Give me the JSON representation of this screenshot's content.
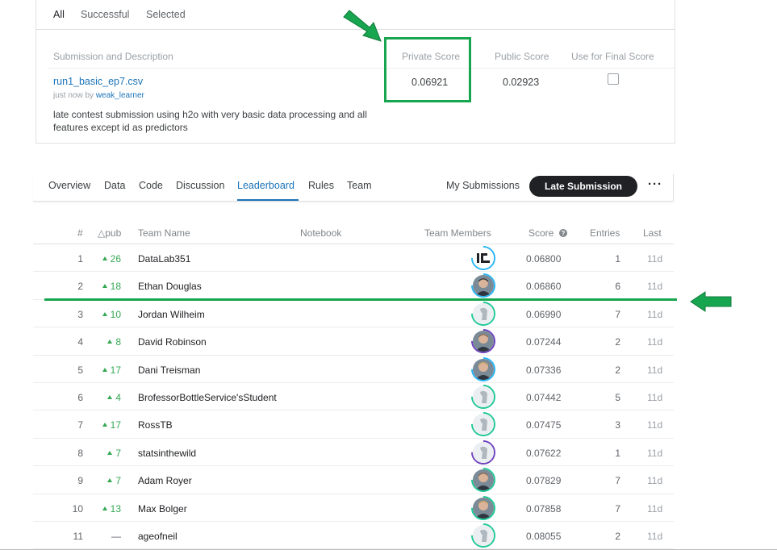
{
  "submissions": {
    "tabs": [
      "All",
      "Successful",
      "Selected"
    ],
    "headers": {
      "description": "Submission and Description",
      "private": "Private Score",
      "public": "Public Score",
      "final": "Use for Final Score"
    },
    "row": {
      "file": "run1_basic_ep7.csv",
      "time": "just now by ",
      "user": "weak_learner",
      "description": "late contest submission using h2o with very basic data processing and all features except id as predictors",
      "private_score": "0.06921",
      "public_score": "0.02923",
      "use_for_final": false
    }
  },
  "nav": {
    "tabs": [
      "Overview",
      "Data",
      "Code",
      "Discussion",
      "Leaderboard",
      "Rules",
      "Team"
    ],
    "active_tab": "Leaderboard",
    "my_submissions": "My Submissions",
    "late_submission": "Late Submission",
    "more": "···"
  },
  "leaderboard": {
    "headers": {
      "rank": "#",
      "delta": "△pub",
      "team": "Team Name",
      "notebook": "Notebook",
      "members": "Team Members",
      "score": "Score",
      "entries": "Entries",
      "last": "Last"
    },
    "rows": [
      {
        "rank": "1",
        "delta": "26",
        "team": "DataLab351",
        "score": "0.06800",
        "entries": "1",
        "last": "11d",
        "ring": "#29b6f6",
        "avatar": "logo"
      },
      {
        "rank": "2",
        "delta": "18",
        "team": "Ethan Douglas",
        "score": "0.06860",
        "entries": "6",
        "last": "11d",
        "ring": "#29b6f6",
        "avatar": "photo"
      },
      {
        "rank": "3",
        "delta": "10",
        "team": "Jordan Wilheim",
        "score": "0.06990",
        "entries": "7",
        "last": "11d",
        "ring": "#20c997",
        "avatar": "default"
      },
      {
        "rank": "4",
        "delta": "8",
        "team": "David Robinson",
        "score": "0.07244",
        "entries": "2",
        "last": "11d",
        "ring": "#6f42c1",
        "avatar": "photo"
      },
      {
        "rank": "5",
        "delta": "17",
        "team": "Dani Treisman",
        "score": "0.07336",
        "entries": "2",
        "last": "11d",
        "ring": "#29b6f6",
        "avatar": "photo"
      },
      {
        "rank": "6",
        "delta": "4",
        "team": "BrofessorBottleService'sStudent",
        "score": "0.07442",
        "entries": "5",
        "last": "11d",
        "ring": "#20c997",
        "avatar": "default"
      },
      {
        "rank": "7",
        "delta": "17",
        "team": "RossTB",
        "score": "0.07475",
        "entries": "3",
        "last": "11d",
        "ring": "#20c997",
        "avatar": "default"
      },
      {
        "rank": "8",
        "delta": "7",
        "team": "statsinthewild",
        "score": "0.07622",
        "entries": "1",
        "last": "11d",
        "ring": "#6f42c1",
        "avatar": "default"
      },
      {
        "rank": "9",
        "delta": "7",
        "team": "Adam Royer",
        "score": "0.07829",
        "entries": "7",
        "last": "11d",
        "ring": "#20c997",
        "avatar": "photo"
      },
      {
        "rank": "10",
        "delta": "13",
        "team": "Max Bolger",
        "score": "0.07858",
        "entries": "7",
        "last": "11d",
        "ring": "#20c997",
        "avatar": "photo"
      },
      {
        "rank": "11",
        "delta": "—",
        "team": "ageofneil",
        "score": "0.08055",
        "entries": "2",
        "last": "11d",
        "ring": "#20c997",
        "avatar": "default"
      }
    ]
  },
  "colors": {
    "highlight": "#18a550",
    "link": "#1a73b8",
    "delta_up": "#34a853"
  }
}
